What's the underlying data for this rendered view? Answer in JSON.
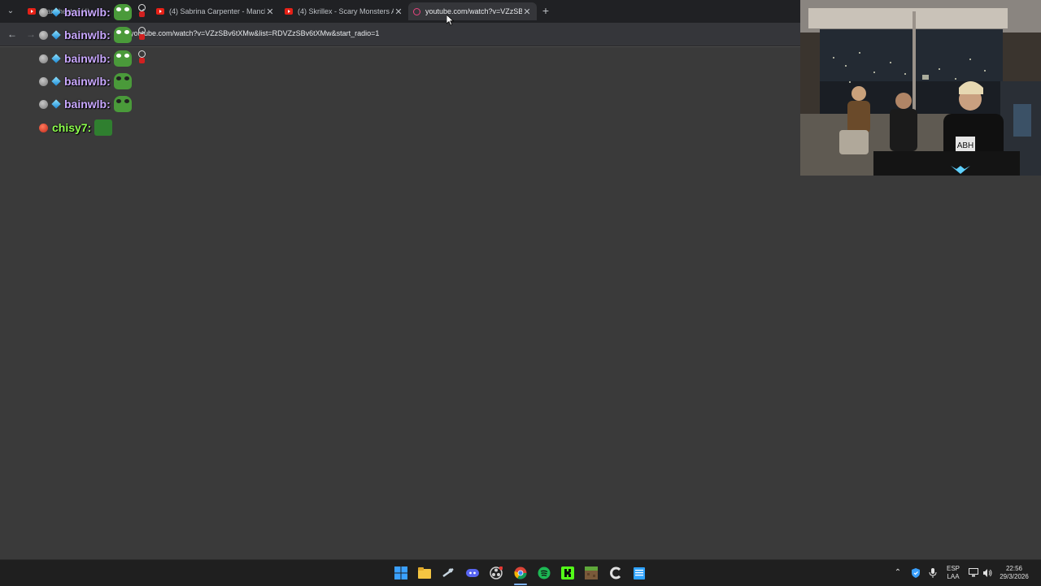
{
  "browser": {
    "tabs": [
      {
        "title": "Manchester (4)...",
        "active": false
      },
      {
        "title": "(4) Sabrina Carpenter - Manche",
        "active": false
      },
      {
        "title": "(4) Skrillex - Scary Monsters An",
        "active": false
      },
      {
        "title": "youtube.com/watch?v=VZzSBv",
        "active": true
      }
    ],
    "url": "youtube.com/watch?v=VZzSBv6tXMw&list=RDVZzSBv6tXMw&start_radio=1"
  },
  "chat": {
    "messages": [
      {
        "user": "bainwlb:",
        "emote": "pepe-guitar"
      },
      {
        "user": "bainwlb:",
        "emote": "pepe-guitar"
      },
      {
        "user": "bainwlb:",
        "emote": "pepe-guitar"
      },
      {
        "user": "bainwlb:",
        "emote": "pepe-glasses"
      },
      {
        "user": "bainwlb:",
        "emote": "pepe-glasses"
      },
      {
        "user": "chisy7:",
        "emote": "pepe-square"
      }
    ],
    "colors": {
      "purple_user": "#c9a8ff",
      "green_user": "#8dff4d"
    }
  },
  "webcam": {
    "shirt_text": "ABH"
  },
  "taskbar": {
    "icons": [
      "windows-start-icon",
      "file-explorer-icon",
      "steam-icon",
      "discord-icon",
      "obs-icon",
      "chrome-icon",
      "spotify-icon",
      "kick-icon",
      "minecraft-icon",
      "ccleaner-icon",
      "notepad-icon"
    ],
    "language": {
      "line1": "ESP",
      "line2": "LAA"
    },
    "clock": {
      "time": "22:56",
      "date": "29/3/2026"
    }
  }
}
